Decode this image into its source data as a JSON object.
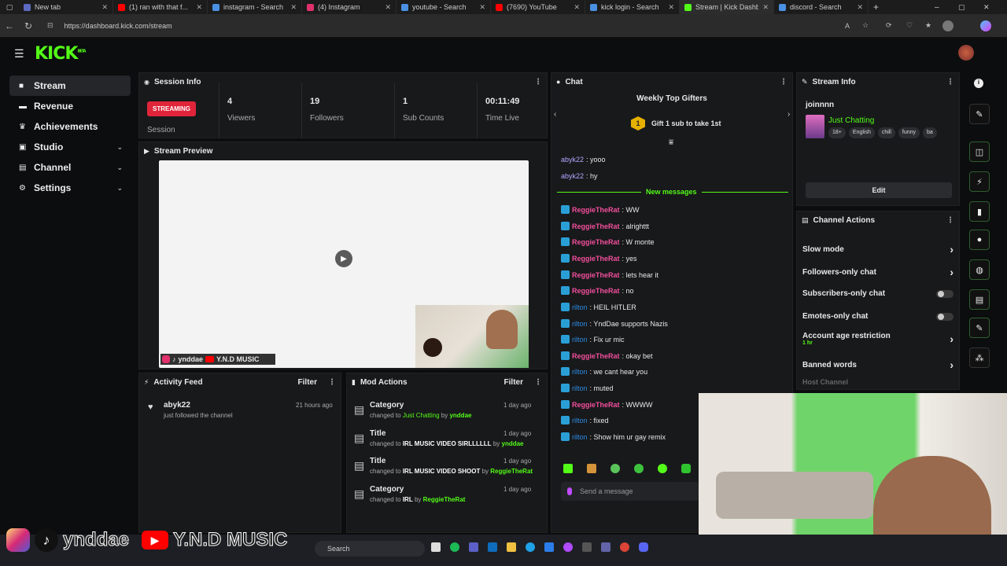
{
  "browser": {
    "tabs": [
      {
        "label": "New tab",
        "color": "#5c6bc0"
      },
      {
        "label": "(1) ran with that f...",
        "color": "#ff0000"
      },
      {
        "label": "instagram - Search",
        "color": "#4a90e2"
      },
      {
        "label": "(4) Instagram",
        "color": "#e1306c"
      },
      {
        "label": "youtube - Search",
        "color": "#4a90e2"
      },
      {
        "label": "(7690) YouTube",
        "color": "#ff0000"
      },
      {
        "label": "kick login - Search",
        "color": "#4a90e2"
      },
      {
        "label": "Stream | Kick Dashboard",
        "color": "#53fc18"
      },
      {
        "label": "discord - Search",
        "color": "#4a90e2"
      }
    ],
    "url": "https://dashboard.kick.com/stream"
  },
  "app": {
    "logo": "KICK",
    "logo_badge": "BETA"
  },
  "sidebar": {
    "items": [
      {
        "label": "Stream",
        "icon": "video-icon",
        "expand": false
      },
      {
        "label": "Revenue",
        "icon": "money-icon",
        "expand": false
      },
      {
        "label": "Achievements",
        "icon": "trophy-icon",
        "expand": false
      },
      {
        "label": "Studio",
        "icon": "studio-icon",
        "expand": true
      },
      {
        "label": "Channel",
        "icon": "channel-icon",
        "expand": true
      },
      {
        "label": "Settings",
        "icon": "gear-icon",
        "expand": true
      }
    ]
  },
  "session": {
    "title": "Session Info",
    "badge": "STREAMING",
    "session_label": "Session",
    "stats": [
      {
        "value": "4",
        "label": "Viewers"
      },
      {
        "value": "19",
        "label": "Followers"
      },
      {
        "value": "1",
        "label": "Sub Counts"
      },
      {
        "value": "00:11:49",
        "label": "Time Live"
      }
    ]
  },
  "preview": {
    "title": "Stream Preview",
    "overlay_handle": "ynddae",
    "overlay_music": "Y.N.D MUSIC"
  },
  "activity": {
    "title": "Activity Feed",
    "filter": "Filter",
    "items": [
      {
        "user": "abyk22",
        "text": "just followed the channel",
        "time": "21 hours ago"
      }
    ]
  },
  "mod": {
    "title": "Mod Actions",
    "filter": "Filter",
    "items": [
      {
        "title": "Category",
        "prefix": "changed to",
        "value": "Just Chatting",
        "by": "by",
        "user": "ynddae",
        "time": "1 day ago"
      },
      {
        "title": "Title",
        "prefix": "changed to",
        "value": "IRL MUSIC VIDEO SIRLLLLLL",
        "by": "by",
        "user": "ynddae",
        "time": "1 day ago"
      },
      {
        "title": "Title",
        "prefix": "changed to",
        "value": "IRL MUSIC VIDEO SHOOT",
        "by": "by",
        "user": "ReggieTheRat",
        "time": "1 day ago"
      },
      {
        "title": "Category",
        "prefix": "changed to",
        "value": "IRL",
        "by": "by",
        "user": "ReggieTheRat",
        "time": "1 day ago"
      }
    ]
  },
  "chat": {
    "title": "Chat",
    "gifters_title": "Weekly Top Gifters",
    "gift_rank": "1",
    "gift_text": "Gift 1 sub to take 1st",
    "new_messages": "New messages",
    "placeholder": "Send a message",
    "messages": [
      {
        "user": "abyk22",
        "text": "yooo",
        "style": "u3",
        "badge": false
      },
      {
        "user": "abyk22",
        "text": "hy",
        "style": "u3",
        "badge": false
      },
      {
        "user": "ReggieTheRat",
        "text": "WW",
        "style": "u1",
        "badge": true
      },
      {
        "user": "ReggieTheRat",
        "text": "alrighttt",
        "style": "u1",
        "badge": true
      },
      {
        "user": "ReggieTheRat",
        "text": "W monte",
        "style": "u1",
        "badge": true
      },
      {
        "user": "ReggieTheRat",
        "text": "yes",
        "style": "u1",
        "badge": true
      },
      {
        "user": "ReggieTheRat",
        "text": "lets hear it",
        "style": "u1",
        "badge": true
      },
      {
        "user": "ReggieTheRat",
        "text": "no",
        "style": "u1",
        "badge": true
      },
      {
        "user": "rilton",
        "text": "HEIL HITLER",
        "style": "u2",
        "badge": true
      },
      {
        "user": "rilton",
        "text": "YndDae supports Nazis",
        "style": "u2",
        "badge": true
      },
      {
        "user": "rilton",
        "text": "Fix ur mic",
        "style": "u2",
        "badge": true
      },
      {
        "user": "ReggieTheRat",
        "text": "okay bet",
        "style": "u1",
        "badge": true
      },
      {
        "user": "rilton",
        "text": "we cant hear you",
        "style": "u2",
        "badge": true
      },
      {
        "user": "rilton",
        "text": "muted",
        "style": "u2",
        "badge": true
      },
      {
        "user": "ReggieTheRat",
        "text": "WWWW",
        "style": "u1",
        "badge": true
      },
      {
        "user": "rilton",
        "text": "fixed",
        "style": "u2",
        "badge": true
      },
      {
        "user": "rilton",
        "text": "Show him ur gay remix",
        "style": "u2",
        "badge": true
      }
    ]
  },
  "stream_info": {
    "title": "Stream Info",
    "username": "joinnnn",
    "category": "Just Chatting",
    "tags": [
      "18+",
      "English",
      "chill",
      "funny",
      "ba"
    ],
    "edit": "Edit"
  },
  "channel_actions": {
    "title": "Channel Actions",
    "items": [
      {
        "label": "Slow mode",
        "type": "arrow"
      },
      {
        "label": "Followers-only chat",
        "type": "arrow"
      },
      {
        "label": "Subscribers-only chat",
        "type": "toggle"
      },
      {
        "label": "Emotes-only chat",
        "type": "toggle"
      },
      {
        "label": "Account age restriction",
        "sub": "1 hr",
        "type": "arrow"
      },
      {
        "label": "Banned words",
        "type": "arrow"
      },
      {
        "label": "Host Channel",
        "type": "none"
      }
    ]
  },
  "overlay_bottom": {
    "handle": "ynddae",
    "music": "Y.N.D MUSIC"
  },
  "taskbar": {
    "search": "Search"
  },
  "colors": {
    "accent": "#53fc18",
    "live": "#e0253b"
  }
}
